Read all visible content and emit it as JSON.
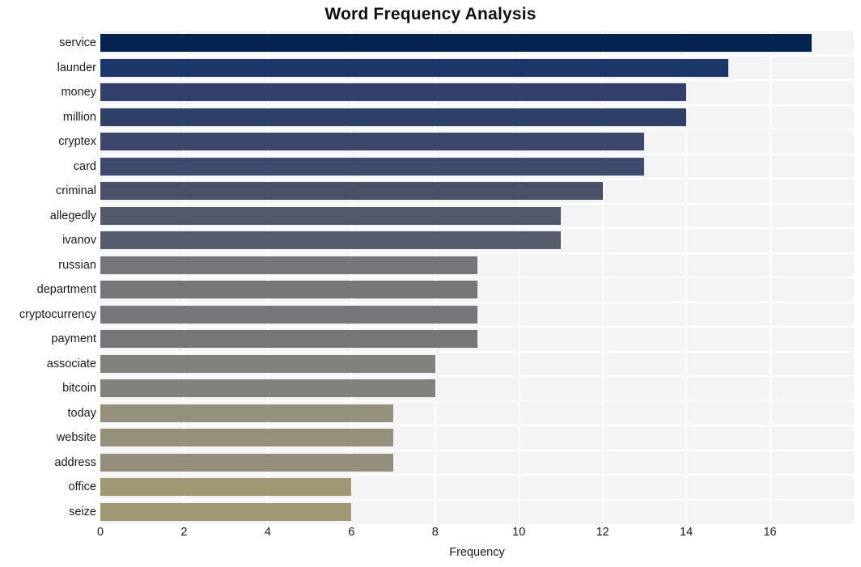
{
  "chart_data": {
    "type": "bar",
    "orientation": "horizontal",
    "title": "Word Frequency Analysis",
    "xlabel": "Frequency",
    "ylabel": "",
    "categories": [
      "service",
      "launder",
      "money",
      "million",
      "cryptex",
      "card",
      "criminal",
      "allegedly",
      "ivanov",
      "russian",
      "department",
      "cryptocurrency",
      "payment",
      "associate",
      "bitcoin",
      "today",
      "website",
      "address",
      "office",
      "seize"
    ],
    "values": [
      17,
      15,
      14,
      14,
      13,
      13,
      12,
      11,
      11,
      9,
      9,
      9,
      9,
      8,
      8,
      7,
      7,
      7,
      6,
      6
    ],
    "bar_colors": [
      "#04234f",
      "#1b3668",
      "#33406c",
      "#2e3f68",
      "#3c476b",
      "#3e4a6e",
      "#4a5166",
      "#525969",
      "#555c6b",
      "#75757a",
      "#76767a",
      "#76767a",
      "#76767a",
      "#82817b",
      "#82817b",
      "#95907b",
      "#95907b",
      "#938e79",
      "#a09873",
      "#a09873"
    ],
    "xticks": [
      0,
      2,
      4,
      6,
      8,
      10,
      12,
      14,
      16
    ],
    "xlim": [
      0,
      18
    ],
    "grid": true,
    "grid_color": "#ffffff",
    "plot_background": "#f4f4f6",
    "legend": null
  }
}
